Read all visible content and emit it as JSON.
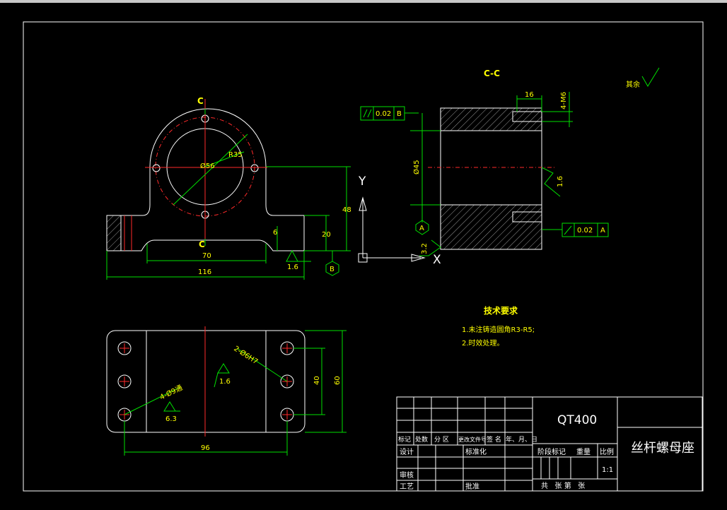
{
  "drawing": {
    "section_label": "C-C",
    "cut_label_top": "C",
    "cut_label_bottom": "C",
    "surface_rest": "其余",
    "front_view_dims": {
      "d_pcd": "Ø56",
      "d_bore": "R35",
      "w_total": "116",
      "w_inner": "70",
      "h_total": "48",
      "h_base": "20",
      "h_small": "6",
      "roughness": "1.6",
      "datum_b": "B"
    },
    "section_view_dims": {
      "len_16": "16",
      "thread": "4-M6",
      "bore": "Ø45",
      "tol_parallel": "0.02",
      "tol_perp": "0.02",
      "datum_b_ref": "B",
      "datum_a_ref": "A",
      "rough_16": "1.6",
      "rough_32": "3.2",
      "datum_a": "A"
    },
    "top_view_dims": {
      "holes_4": "4-Ø9通",
      "holes_2": "2-Ø6H7",
      "len_96": "96",
      "len_40": "40",
      "len_60": "60",
      "rough_16": "1.6",
      "rough_63": "6.3"
    },
    "axis_y": "Y",
    "axis_x": "X",
    "tech_title": "技术要求",
    "tech_items": [
      "1.未注铸造圆角R3-R5;",
      "2.时效处理。"
    ]
  },
  "title_block": {
    "material": "QT400",
    "part_name": "丝杆螺母座",
    "rev_headers": [
      "标记",
      "处数",
      "分 区",
      "更改文件号",
      "签 名",
      "年、月、日"
    ],
    "design": "设计",
    "standardize": "标准化",
    "check": "审核",
    "process": "工艺",
    "approve": "批准",
    "stage_mark": "阶段标记",
    "weight": "重量",
    "scale_label": "比例",
    "scale": "1:1",
    "sheets": "共   张 第   张"
  }
}
